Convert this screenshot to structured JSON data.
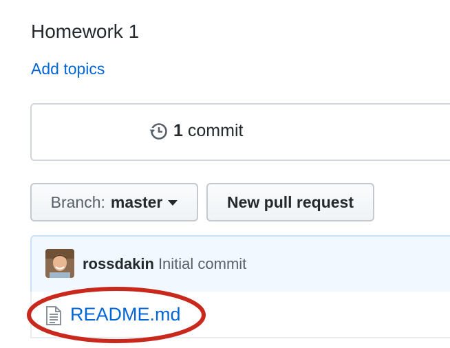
{
  "repo": {
    "description": "Homework 1",
    "add_topics": "Add topics"
  },
  "summary": {
    "commits_count": "1",
    "commits_label": "commit",
    "icon": "history-icon"
  },
  "toolbar": {
    "branch_prefix": "Branch:",
    "branch_name": "master",
    "new_pr_label": "New pull request"
  },
  "commit": {
    "author": "rossdakin",
    "message": "Initial commit"
  },
  "files": [
    {
      "name": "README.md",
      "icon": "file-text-icon"
    }
  ],
  "colors": {
    "link": "#0366d6",
    "annotation": "#c9281d",
    "commit_bg": "#f1f8ff"
  }
}
